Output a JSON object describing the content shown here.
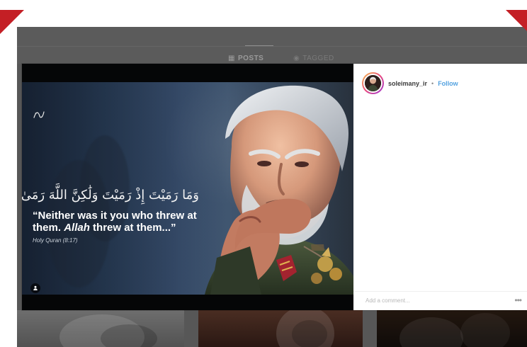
{
  "background": {
    "tabs": [
      {
        "label": "POSTS",
        "icon": "grid-icon"
      },
      {
        "label": "TAGGED",
        "icon": "tag-icon"
      }
    ]
  },
  "modal": {
    "author": {
      "username": "soleimany_ir",
      "separator": "•",
      "follow_label": "Follow"
    },
    "poster": {
      "arabic_text": "وَمَا رَمَيْتَ إِذْ رَمَيْتَ وَلَٰكِنَّ اللَّهَ رَمَىٰ",
      "quote_line1": "“Neither was it you who threw at",
      "quote_line2_prefix": "them. ",
      "quote_line2_italic": "Allah",
      "quote_line2_suffix": " threw at them...”",
      "citation": "Holy Quran (8:17)"
    },
    "comment_placeholder": "Add a comment...",
    "more_label": "•••"
  },
  "colors": {
    "follow_blue": "#53a2e0",
    "accent_red": "#c41f25",
    "overlay_gray": "#575757"
  }
}
